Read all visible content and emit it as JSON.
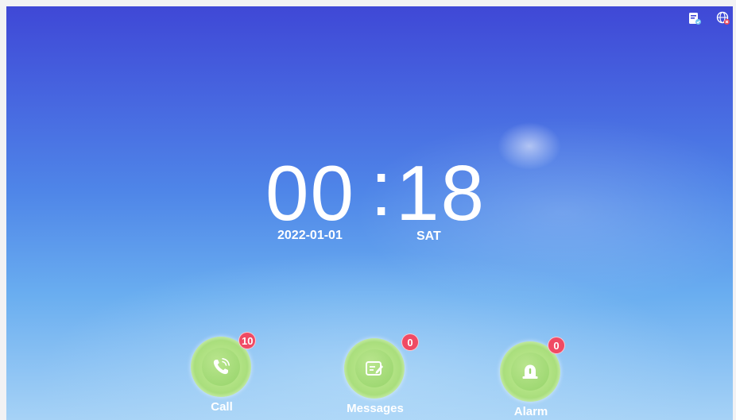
{
  "status_bar": {
    "icons": [
      "contact-card-icon",
      "network-disconnected-icon"
    ]
  },
  "clock": {
    "hours": "00",
    "separator": ":",
    "minutes": "18",
    "date": "2022-01-01",
    "weekday": "SAT"
  },
  "apps": [
    {
      "label": "Call",
      "badge": "10",
      "icon": "phone-call-icon"
    },
    {
      "label": "Messages",
      "badge": "0",
      "icon": "message-edit-icon"
    },
    {
      "label": "Alarm",
      "badge": "0",
      "icon": "alarm-bell-icon"
    }
  ],
  "colors": {
    "badge": "#f04a64",
    "icon_ring": "#a9de7c",
    "text": "#ffffff"
  }
}
